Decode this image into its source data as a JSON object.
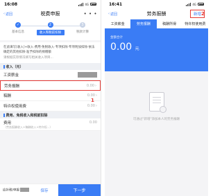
{
  "left": {
    "status": {
      "time": "16:08",
      "network": "4G"
    },
    "nav": {
      "back": "返回",
      "title": "税费申报",
      "more": "• • •"
    },
    "steps": [
      {
        "num": "1",
        "label": "基本信息"
      },
      {
        "num": "2",
        "label": "收入和税前扣除"
      },
      {
        "num": "3",
        "label": "税款计算"
      }
    ],
    "notice": {
      "text": "在此填写[收入]+收入·费用·免税收入·专项扣除·专项附加扣除·依法确定的其他扣除·准予扣除的捐赠额",
      "hint": "请根据实际情况填写相关收入项目..."
    },
    "section_income": "收入（元）",
    "rows": [
      {
        "label": "工资薪金",
        "value": ""
      },
      {
        "label": "劳务报酬",
        "value": "0.00"
      },
      {
        "label": "稿酬",
        "value": "0.00"
      },
      {
        "label": "特许权使用费",
        "value": "0.00"
      }
    ],
    "section_deduct": "费用、免税收入和税前扣除",
    "fee_row": {
      "label": "费用",
      "value": "0.00",
      "note": "（劳务报酬收入+稿酬收入+特许权...）"
    },
    "annotation": "1",
    "bottom": {
      "label": "应补税/申报",
      "save": "保存",
      "next": "下一步"
    }
  },
  "right": {
    "status": {
      "time": "16:41",
      "network": "4G"
    },
    "nav": {
      "back": "返回",
      "title": "劳务报酬",
      "new": "新增"
    },
    "annotation": "2",
    "tabs": [
      "工资薪金",
      "劳务报酬",
      "稿酬所得",
      "特许权使用费"
    ],
    "active_tab": 1,
    "card": {
      "label": "金额合计",
      "amount": "0.00",
      "unit": "元"
    },
    "empty_msg": "可通过\"新增\"添加本人的劳务报酬"
  }
}
